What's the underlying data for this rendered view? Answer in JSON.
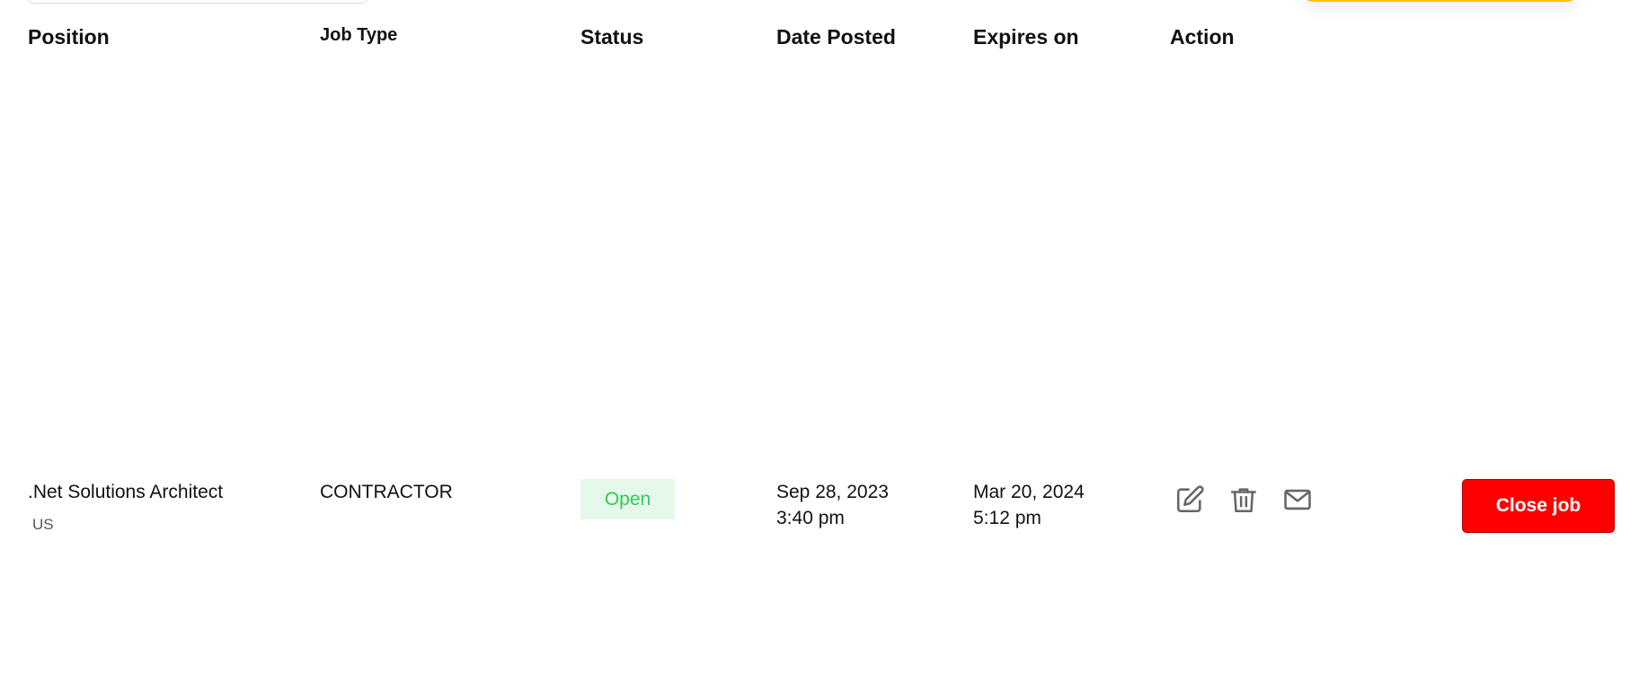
{
  "table": {
    "headers": {
      "position": "Position",
      "job_type": "Job Type",
      "status": "Status",
      "date_posted": "Date Posted",
      "expires_on": "Expires on",
      "action": "Action"
    },
    "rows": [
      {
        "position_title": ".Net Solutions Architect",
        "position_location": "US",
        "job_type": "CONTRACTOR",
        "status": "Open",
        "date_posted": "Sep 28, 2023",
        "time_posted": "3:40 pm",
        "expires_date": "Mar 20, 2024",
        "expires_time": "5:12 pm",
        "actions": {
          "edit_icon": "edit-icon",
          "delete_icon": "trash-icon",
          "email_icon": "mail-icon",
          "close_label": "Close job"
        }
      }
    ]
  },
  "colors": {
    "status_open_bg": "#e6f8ea",
    "status_open_text": "#2ecc55",
    "close_button": "#ff0000",
    "accent_yellow": "#ffc107"
  }
}
